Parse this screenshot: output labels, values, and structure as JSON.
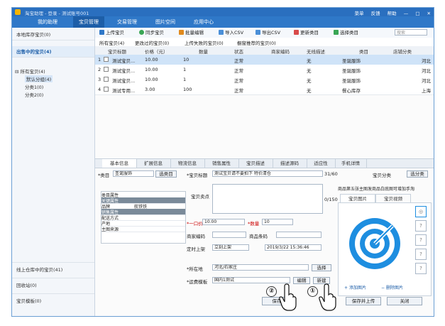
{
  "titlebar": {
    "title": "淘宝助理 - 登录 - 测试账号001",
    "right": [
      "菜单",
      "反馈",
      "帮助",
      "—",
      "□",
      "✕"
    ]
  },
  "nav": {
    "tabs": [
      "我的助理",
      "宝贝管理",
      "交易管理",
      "图片空间",
      "应用中心"
    ]
  },
  "sidebar": {
    "sections": [
      "本地库存宝贝(0)",
      "出售中的宝贝(4)"
    ],
    "tree_root": "所有宝贝(4)",
    "tree_items": [
      "默认分组(4)",
      "分类1(0)",
      "分类2(0)"
    ],
    "bottom": [
      "线上仓库中的宝贝(41)",
      "回收站(0)",
      "宝贝模板(0)"
    ]
  },
  "toolbar": {
    "buttons": [
      "上传宝贝",
      "同步宝贝",
      "批量编辑",
      "导入CSV",
      "导出CSV",
      "更新类目",
      "选择类目",
      "图片搬家"
    ],
    "search_placeholder": "搜索"
  },
  "filters": [
    "所有宝贝(4)",
    "更改过的宝贝(0)",
    "上传失败的宝贝(0)",
    "橱窗推荐的宝贝(0)"
  ],
  "table": {
    "headers": [
      "宝贝标题",
      "价格（元）",
      "数量",
      "状态",
      "商家编码",
      "无线描述",
      "类目",
      "店铺分类"
    ],
    "rows": [
      {
        "num": "1",
        "title": "测试宝贝...",
        "price": "10.00",
        "qty": "10",
        "status": "正常",
        "wireless": "无",
        "cat": "圣诞服饰",
        "store": "河北"
      },
      {
        "num": "2",
        "title": "测试宝贝...",
        "price": "10.00",
        "qty": "1",
        "status": "正常",
        "wireless": "无",
        "cat": "圣诞服饰",
        "store": "河北"
      },
      {
        "num": "3",
        "title": "测试宝贝...",
        "price": "10.00",
        "qty": "1",
        "status": "正常",
        "wireless": "无",
        "cat": "圣诞服饰",
        "store": "河北"
      },
      {
        "num": "4",
        "title": "测试专用...",
        "price": "3.00",
        "qty": "100",
        "status": "正常",
        "wireless": "无",
        "cat": "餐心库存",
        "store": "上海"
      }
    ]
  },
  "detail_tabs": [
    "基本信息",
    "扩展信息",
    "物流信息",
    "销售属性",
    "宝贝描述",
    "描述源码",
    "适应性",
    "手机详情"
  ],
  "form": {
    "category_label": "*类目",
    "category_value": "圣诞服饰",
    "category_btn": "选类目",
    "title_label": "*宝贝标题",
    "title_value": "测试宝贝请不要拍下 特价清仓",
    "title_count": "31/60",
    "store_cat_label": "宝贝分类",
    "store_cat_btn": "选分类",
    "selling_point_label": "宝贝卖点",
    "selling_point_count": "0/150",
    "price_label": "*一口价",
    "price_value": "10.00",
    "qty_label": "*数量",
    "qty_value": "10",
    "merchant_code_label": "商家编码",
    "barcode_label": "商品条码",
    "listing_label": "定时上架",
    "listing_value": "立刻上架",
    "datetime_value": "2019/3/22 15:36:46",
    "location_label": "*所在地",
    "location_value": "河北/石家庄",
    "location_btn": "选择",
    "freight_label": "*运费模板",
    "freight_value": "国内1测试",
    "edit_btn": "编辑",
    "new_btn": "新建"
  },
  "props": {
    "rows": [
      "类目属性",
      "关键属性",
      "品牌",
      "销售属性",
      "配送方式",
      "产地",
      "主图来源"
    ],
    "brand_value": "航铁铁"
  },
  "images": {
    "notice": "商品第五张主图发商品白底图可增加手淘",
    "tabs": [
      "宝贝图片",
      "宝贝视频"
    ],
    "add_link": "添加图片",
    "delete_link": "删除图片",
    "thumb_placeholder": "?"
  },
  "footer": {
    "buttons": [
      "保存",
      "保存并上传",
      "关闭"
    ]
  },
  "annotations": {
    "step1": "①",
    "step2": "②"
  },
  "colors": {
    "nav": "#2f78c8",
    "titlebar": "#2a6fbf",
    "selection": "#cfe3f8",
    "logo": "#1e8ee0"
  }
}
